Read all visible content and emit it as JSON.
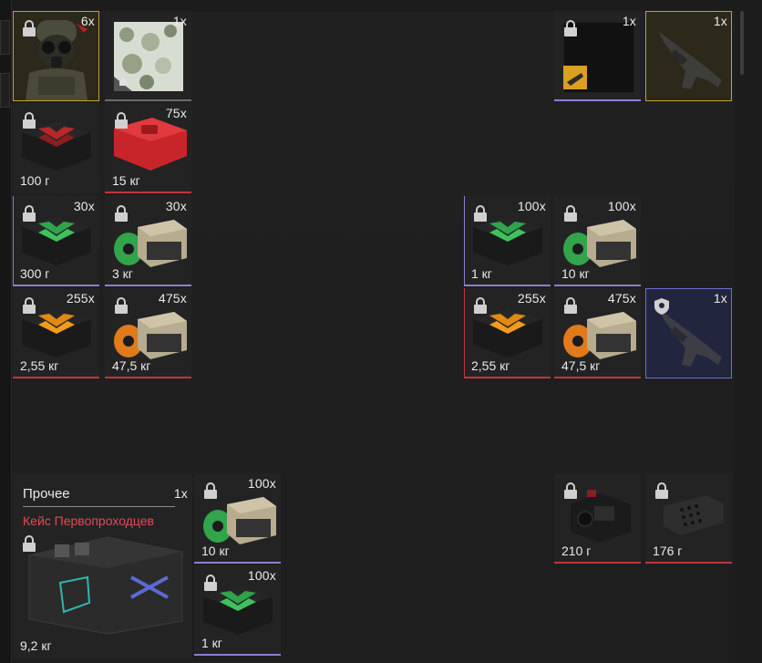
{
  "inventory": {
    "row1": {
      "armor": {
        "count": "6x"
      },
      "camo": {
        "count": "1x"
      },
      "blueprint": {
        "count": "1x"
      },
      "rifle_gold": {
        "count": "1x"
      }
    },
    "row2": {
      "box_red_dark": {
        "weight": "100 г"
      },
      "box_red": {
        "count": "75x",
        "weight": "15 кг"
      }
    },
    "row3": {
      "box_green_a": {
        "count": "30x",
        "weight": "300 г"
      },
      "crate_green_a": {
        "count": "30x",
        "weight": "3 кг"
      },
      "box_green_b": {
        "count": "100x",
        "weight": "1 кг"
      },
      "crate_green_b": {
        "count": "100x",
        "weight": "10 кг"
      }
    },
    "row4": {
      "box_orange_a": {
        "count": "255x",
        "weight": "2,55 кг"
      },
      "crate_orange_a": {
        "count": "475x",
        "weight": "47,5 кг"
      },
      "box_orange_b": {
        "count": "255x",
        "weight": "2,55 кг"
      },
      "crate_orange_b": {
        "count": "475x",
        "weight": "47,5 кг"
      },
      "rifle_blue": {
        "count": "1x"
      }
    },
    "row6": {
      "case": {
        "title": "Прочее",
        "subtitle": "Кейс Первопроходцев",
        "count": "1x",
        "weight": "9,2 кг"
      },
      "crate_green_c": {
        "count": "100x",
        "weight": "10 кг"
      },
      "scope": {
        "weight": "210 г"
      },
      "muzzle": {
        "weight": "176 г"
      }
    },
    "row7": {
      "box_green_c": {
        "count": "100x",
        "weight": "1 кг"
      }
    }
  },
  "colors": {
    "gold": "#bfa23a",
    "blue": "#6b6fcf",
    "red_rarity": "#c2343f",
    "purple_rarity": "#8a7fd6",
    "case_subtitle": "#e24b55"
  }
}
